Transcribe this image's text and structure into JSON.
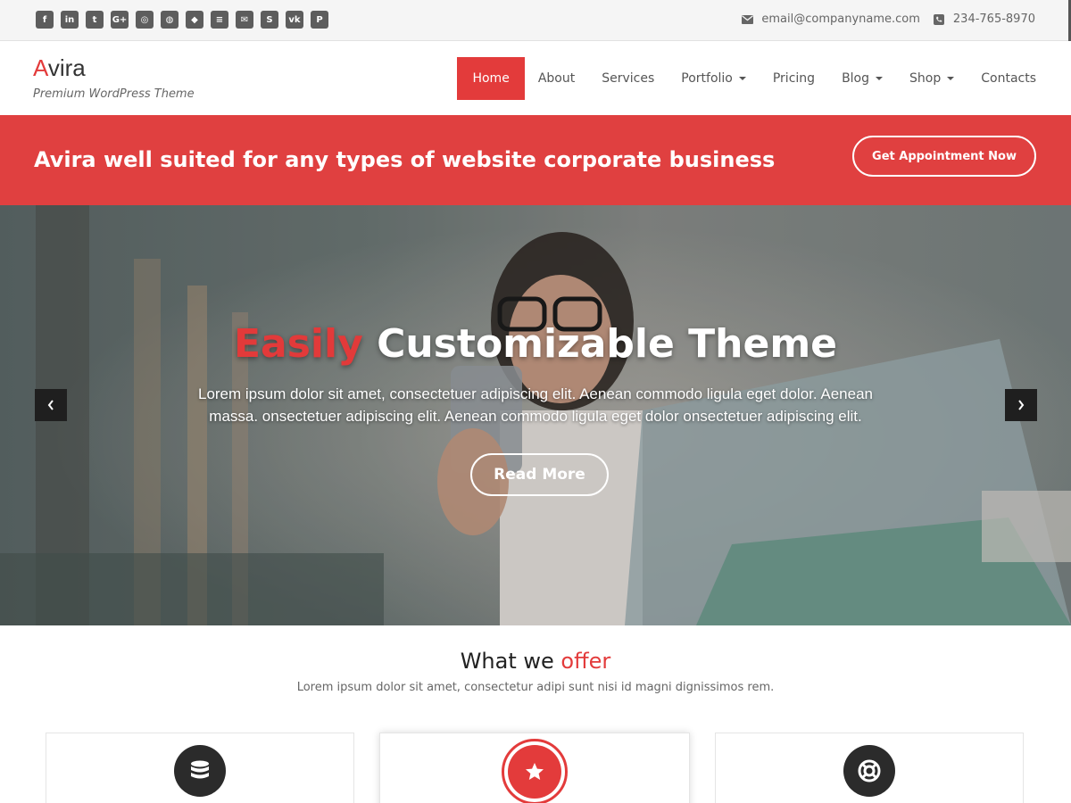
{
  "topbar": {
    "social": [
      {
        "icon": "facebook-icon",
        "glyph": "f"
      },
      {
        "icon": "linkedin-icon",
        "glyph": "in"
      },
      {
        "icon": "twitter-icon",
        "glyph": "t"
      },
      {
        "icon": "google-plus-icon",
        "glyph": "G+"
      },
      {
        "icon": "instagram-icon",
        "glyph": "◎"
      },
      {
        "icon": "dribbble-icon",
        "glyph": "◍"
      },
      {
        "icon": "github-icon",
        "glyph": "◆"
      },
      {
        "icon": "stackoverflow-icon",
        "glyph": "≡"
      },
      {
        "icon": "envelope-icon",
        "glyph": "✉"
      },
      {
        "icon": "skype-icon",
        "glyph": "S"
      },
      {
        "icon": "vk-icon",
        "glyph": "vk"
      },
      {
        "icon": "pinterest-icon",
        "glyph": "P"
      }
    ],
    "email": "email@companyname.com",
    "phone": "234-765-8970"
  },
  "header": {
    "logo_first": "A",
    "logo_rest": "vira",
    "tagline": "Premium WordPress Theme",
    "nav": [
      {
        "label": "Home",
        "active": true,
        "dropdown": false
      },
      {
        "label": "About",
        "active": false,
        "dropdown": false
      },
      {
        "label": "Services",
        "active": false,
        "dropdown": false
      },
      {
        "label": "Portfolio",
        "active": false,
        "dropdown": true
      },
      {
        "label": "Pricing",
        "active": false,
        "dropdown": false
      },
      {
        "label": "Blog",
        "active": false,
        "dropdown": true
      },
      {
        "label": "Shop",
        "active": false,
        "dropdown": true
      },
      {
        "label": "Contacts",
        "active": false,
        "dropdown": false
      }
    ]
  },
  "banner": {
    "text": "Avira well suited for any types of website corporate business",
    "button": "Get Appointment Now"
  },
  "hero": {
    "title_accent": "Easily",
    "title_rest": " Customizable Theme",
    "description": "Lorem ipsum dolor sit amet, consectetuer adipiscing elit. Aenean commodo ligula eget dolor. Aenean massa. onsectetuer adipiscing elit. Aenean commodo ligula eget dolor onsectetuer adipiscing elit.",
    "button": "Read More"
  },
  "offer": {
    "title_main": "What we ",
    "title_accent": "offer",
    "subtitle": "Lorem ipsum dolor sit amet, consectetur adipi sunt nisi id magni dignissimos rem.",
    "cards": [
      {
        "icon": "database-icon"
      },
      {
        "icon": "star-icon"
      },
      {
        "icon": "life-ring-icon"
      }
    ]
  },
  "colors": {
    "accent": "#e33b3b",
    "dark": "#2b2b2b"
  }
}
